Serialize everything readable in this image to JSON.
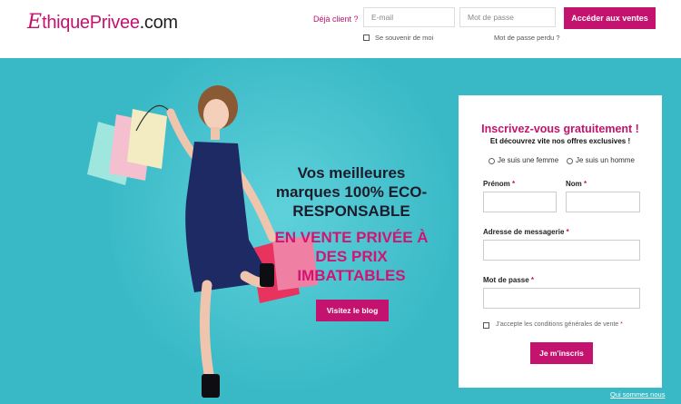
{
  "header": {
    "logo": {
      "part1": "E",
      "part2": "thique",
      "part3": "Privee",
      "part4": ".com"
    },
    "already_client": "Déjà client ?",
    "email_placeholder": "E-mail",
    "password_placeholder": "Mot de passe",
    "login_button": "Accéder aux ventes",
    "remember_me": "Se souvenir de moi",
    "forgot_password": "Mot de passe perdu ?"
  },
  "hero": {
    "headline": "Vos meilleures marques 100% ECO-RESPONSABLE",
    "subheadline": "EN VENTE PRIVÉE À DES PRIX IMBATTABLES",
    "blog_button": "Visitez le blog"
  },
  "signup": {
    "title": "Inscrivez-vous gratuitement !",
    "subtitle": "Et découvrez vite nos offres exclusives !",
    "radio_female": "Je suis une femme",
    "radio_male": "Je suis un homme",
    "first_name_label": "Prénom",
    "last_name_label": "Nom",
    "email_label": "Adresse de messagerie",
    "password_label": "Mot de passe",
    "required_mark": "*",
    "terms": "J'accepte les conditions générales de vente",
    "submit": "Je m'inscris"
  },
  "footer": {
    "about": "Qui sommes nous"
  },
  "colors": {
    "brand": "#c4126f",
    "hero_bg": "#39b9c6"
  }
}
